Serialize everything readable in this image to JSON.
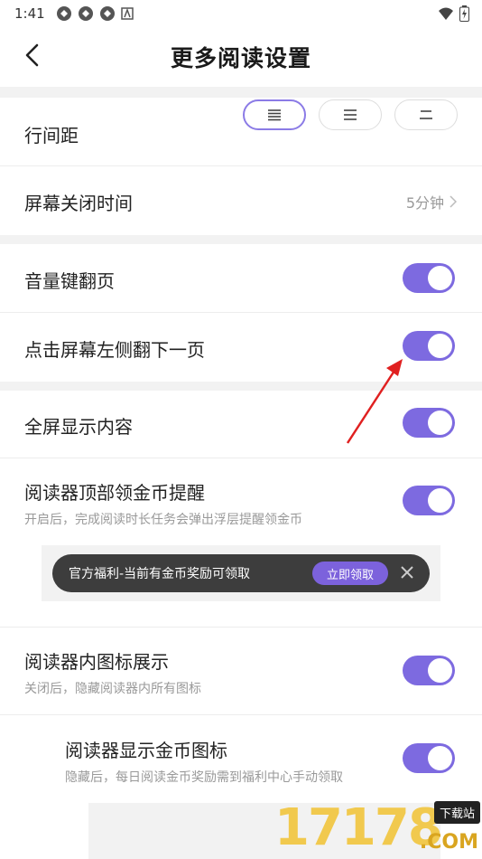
{
  "status_bar": {
    "time": "1:41",
    "icons_left": [
      "notification-icon",
      "notification-icon",
      "notification-icon",
      "app-icon"
    ],
    "icons_right": [
      "wifi-icon",
      "battery-icon"
    ]
  },
  "nav": {
    "title": "更多阅读设置",
    "back_icon": "chevron-left-icon"
  },
  "settings": {
    "line_spacing": {
      "label": "行间距",
      "options": [
        "large",
        "medium",
        "small"
      ],
      "selected_index": 0
    },
    "screen_off": {
      "label": "屏幕关闭时间",
      "value": "5分钟"
    },
    "volume_key": {
      "label": "音量键翻页",
      "on": true
    },
    "tap_left": {
      "label": "点击屏幕左侧翻下一页",
      "on": true
    },
    "fullscreen": {
      "label": "全屏显示内容",
      "on": true
    },
    "coin_remind": {
      "label": "阅读器顶部领金币提醒",
      "sub": "开启后，完成阅读时长任务会弹出浮层提醒领金币",
      "on": true
    },
    "toast_preview": {
      "text": "官方福利-当前有金币奖励可领取",
      "button": "立即领取"
    },
    "icon_display": {
      "label": "阅读器内图标展示",
      "sub": "关闭后，隐藏阅读器内所有图标",
      "on": true
    },
    "coin_icon": {
      "label": "阅读器显示金币图标",
      "sub": "隐藏后，每日阅读金币奖励需到福利中心手动领取",
      "on": true
    }
  },
  "colors": {
    "accent": "#7d6ae0",
    "arrow": "#e02020"
  },
  "watermark": {
    "digits": "17178",
    "tag": "下载站",
    "domain": ".COM"
  }
}
